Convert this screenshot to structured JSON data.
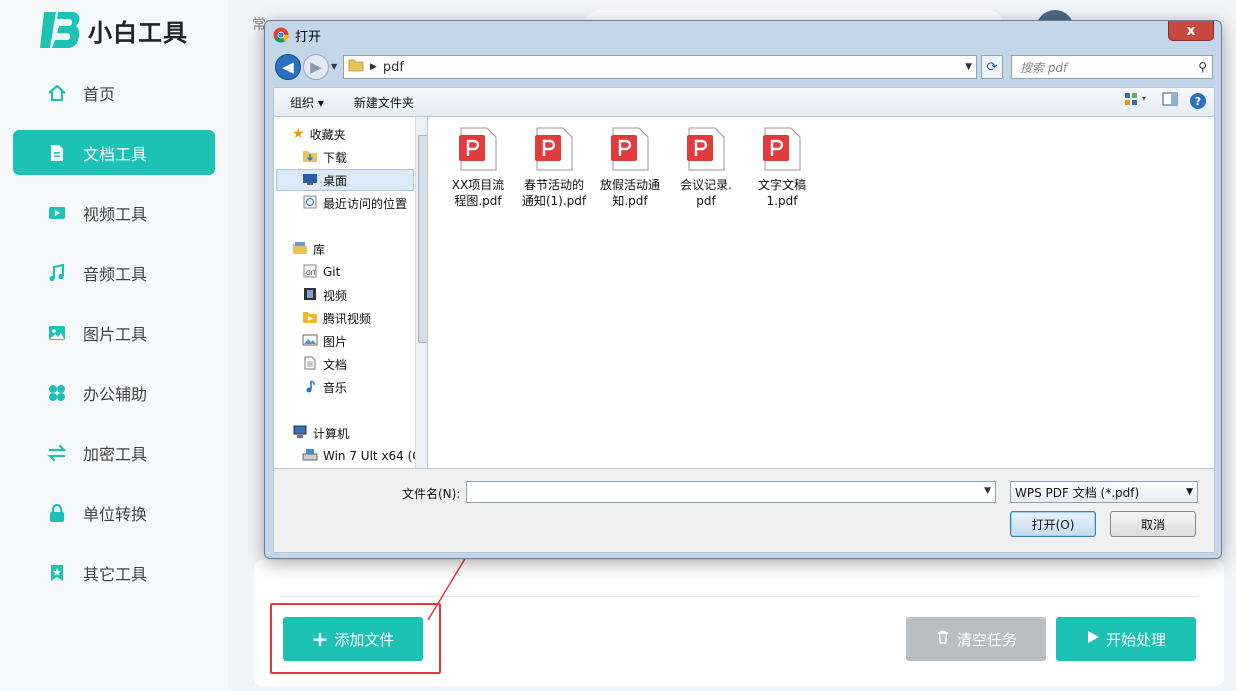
{
  "app": {
    "logo_text": "小白工具",
    "top_hint": "常",
    "accent_color": "#1cc2b4"
  },
  "sidebar": {
    "items": [
      {
        "label": "首页",
        "icon": "home-icon",
        "active": false
      },
      {
        "label": "文档工具",
        "icon": "document-icon",
        "active": true
      },
      {
        "label": "视频工具",
        "icon": "video-icon",
        "active": false
      },
      {
        "label": "音频工具",
        "icon": "music-icon",
        "active": false
      },
      {
        "label": "图片工具",
        "icon": "image-icon",
        "active": false
      },
      {
        "label": "办公辅助",
        "icon": "clover-icon",
        "active": false
      },
      {
        "label": "加密工具",
        "icon": "swap-icon",
        "active": false
      },
      {
        "label": "单位转换",
        "icon": "lock-icon",
        "active": false
      },
      {
        "label": "其它工具",
        "icon": "bookmark-star-icon",
        "active": false
      }
    ]
  },
  "actions": {
    "add_file": "添加文件",
    "clear_tasks": "清空任务",
    "start_processing": "开始处理"
  },
  "dialog": {
    "title": "打开",
    "close_label": "x",
    "address": {
      "folder": "pdf"
    },
    "search_placeholder": "搜索 pdf",
    "toolbar": {
      "organize": "组织 ▾",
      "new_folder": "新建文件夹"
    },
    "nav": {
      "favorites_header": "收藏夹",
      "favorites": [
        "下载",
        "桌面",
        "最近访问的位置"
      ],
      "libraries_header": "库",
      "libraries": [
        "Git",
        "视频",
        "腾讯视频",
        "图片",
        "文档",
        "音乐"
      ],
      "computer_header": "计算机",
      "drives": [
        "Win 7 Ult x64 (C"
      ]
    },
    "files": [
      {
        "name_line1": "XX项目流",
        "name_line2": "程图.pdf"
      },
      {
        "name_line1": "春节活动的",
        "name_line2": "通知(1).pdf"
      },
      {
        "name_line1": "放假活动通",
        "name_line2": "知.pdf"
      },
      {
        "name_line1": "会议记录.",
        "name_line2": "pdf"
      },
      {
        "name_line1": "文字文稿",
        "name_line2": "1.pdf"
      }
    ],
    "filename_label": "文件名(N):",
    "filename_value": "",
    "filetype": "WPS PDF 文档 (*.pdf)",
    "open_button": "打开(O)",
    "cancel_button": "取消"
  }
}
